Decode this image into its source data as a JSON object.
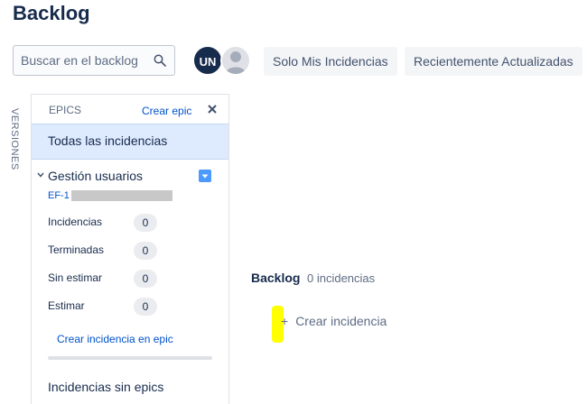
{
  "page": {
    "title": "Backlog"
  },
  "search": {
    "placeholder": "Buscar en el backlog"
  },
  "avatars": {
    "initials": "UN"
  },
  "filters": {
    "mine_label": "Solo Mis Incidencias",
    "recent_label": "Recientemente Actualizadas"
  },
  "side_tabs": {
    "versions": "VERSIONES"
  },
  "epics_panel": {
    "header": "EPICS",
    "create_epic": "Crear epic",
    "all_issues": "Todas las incidencias",
    "epic": {
      "name": "Gestión usuarios",
      "key": "EF-1",
      "color": "#4c9aff",
      "progress": 0,
      "stats": [
        {
          "label": "Incidencias",
          "value": "0"
        },
        {
          "label": "Terminadas",
          "value": "0"
        },
        {
          "label": "Sin estimar",
          "value": "0"
        },
        {
          "label": "Estimar",
          "value": "0"
        }
      ],
      "create_issue_in_epic": "Crear incidencia en epic"
    },
    "issues_without_epics": "Incidencias sin epics"
  },
  "backlog": {
    "title": "Backlog",
    "count": "0 incidencias",
    "create_issue_icon": "+",
    "create_issue": "Crear incidencia"
  }
}
